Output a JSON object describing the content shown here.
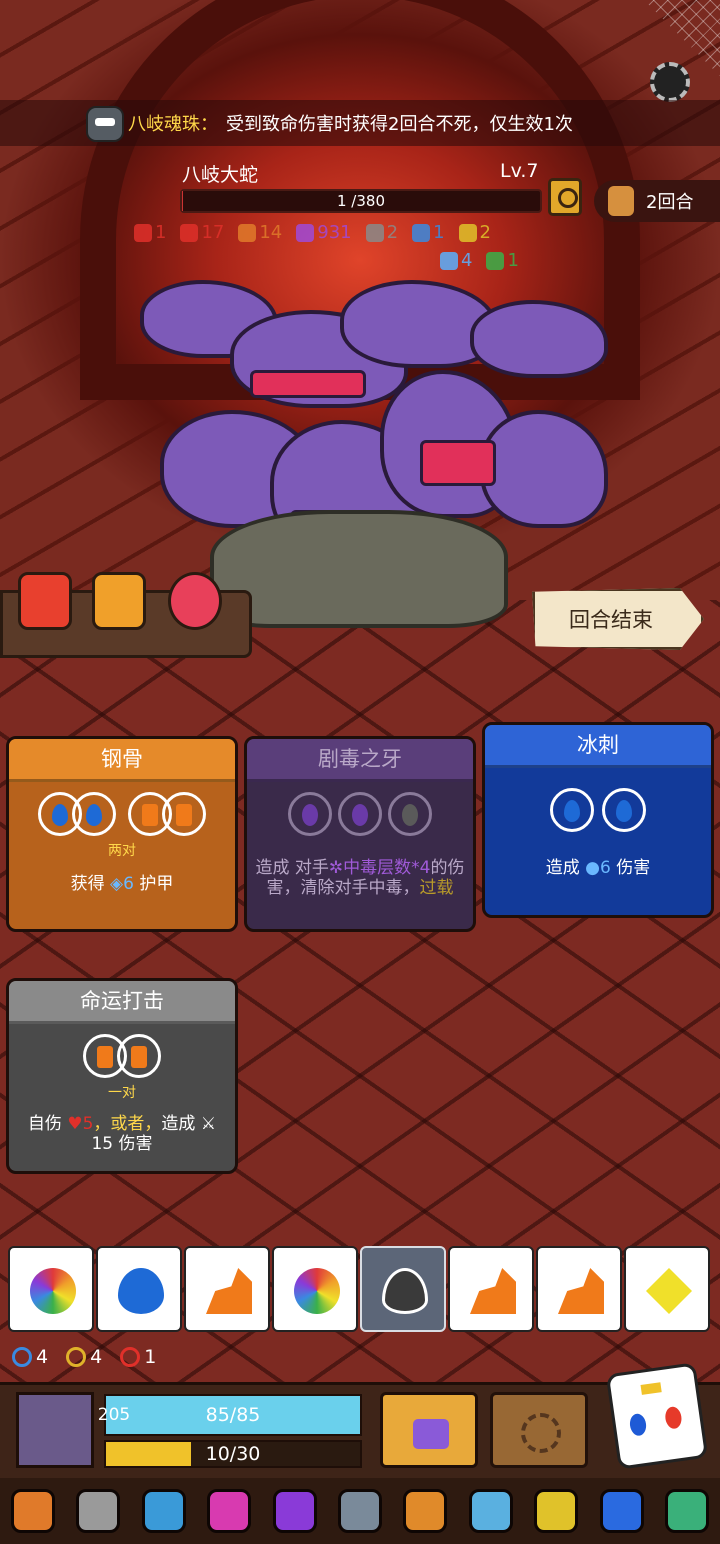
{
  "relic_banner": {
    "name": "八岐魂珠：",
    "text": "受到致命伤害时获得2回合不死，仅生效1次"
  },
  "boss": {
    "name": "八岐大蛇",
    "level": "Lv.7",
    "hp_text": "1 /380",
    "hp_fraction": 0.003
  },
  "turn_counter": "2回合",
  "boss_statuses_row1": [
    {
      "icon": "broken-heart-icon",
      "color": "#e0302a",
      "value": "1"
    },
    {
      "icon": "flame-icon",
      "color": "#e0302a",
      "value": "17"
    },
    {
      "icon": "fire-icon",
      "color": "#e07a2a",
      "value": "14"
    },
    {
      "icon": "poison-icon",
      "color": "#a04ad8",
      "value": "931"
    },
    {
      "icon": "skull-icon",
      "color": "#8a8a8a",
      "value": "2"
    },
    {
      "icon": "chat-icon",
      "color": "#3a8ae0",
      "value": "1"
    },
    {
      "icon": "arrow-icon",
      "color": "#e0c22a",
      "value": "2"
    }
  ],
  "boss_statuses_row2": [
    {
      "icon": "frost-icon",
      "color": "#5ab0ff",
      "value": "4"
    },
    {
      "icon": "leaf-icon",
      "color": "#3ab04a",
      "value": "1"
    }
  ],
  "end_turn_label": "回合结束",
  "cards": {
    "steel_bone": {
      "title": "钢骨",
      "requirement": "两对",
      "desc_pre": "获得",
      "desc_value": "6",
      "desc_post": "护甲"
    },
    "venom_fang": {
      "title": "剧毒之牙",
      "desc_pre": "造成 对手",
      "desc_highlight": "中毒层数*4",
      "desc_mid": "的伤害，清除对手中毒，",
      "desc_end": "过载"
    },
    "ice_spike": {
      "title": "冰刺",
      "desc_pre": "造成",
      "desc_value": "6",
      "desc_post": "伤害"
    },
    "fate_strike": {
      "title": "命运打击",
      "requirement": "一对",
      "desc_pre": "自伤",
      "desc_value": "5",
      "desc_or": "，或者，",
      "desc_mid": "造成",
      "desc_line2": "15 伤害"
    }
  },
  "dice": [
    {
      "face": "rainbow-swirl-icon",
      "selected": false
    },
    {
      "face": "water-drop-icon",
      "selected": false
    },
    {
      "face": "orange-rock-icon",
      "selected": false
    },
    {
      "face": "rainbow-swirl-icon",
      "selected": false
    },
    {
      "face": "gray-flame-icon",
      "selected": true
    },
    {
      "face": "orange-rock-icon",
      "selected": false
    },
    {
      "face": "orange-rock-icon",
      "selected": false
    },
    {
      "face": "yellow-diamond-icon",
      "selected": false
    }
  ],
  "player_buffs": [
    {
      "icon": "blue-shield-icon",
      "color": "#3a8ae0",
      "value": "4"
    },
    {
      "icon": "gold-shield-icon",
      "color": "#e0b22a",
      "value": "4"
    },
    {
      "icon": "red-swirl-icon",
      "color": "#e0302a",
      "value": "1"
    }
  ],
  "player": {
    "shield": "205",
    "hp_text": "85/85",
    "hp_fraction": 1.0,
    "xp_text": "10/30",
    "xp_fraction": 0.333
  },
  "relics": [
    {
      "icon": "crown-icon",
      "color": "#e07a2a"
    },
    {
      "icon": "ghost-icon",
      "color": "#9a9a9a"
    },
    {
      "icon": "blue-box-icon",
      "color": "#3a9ad8"
    },
    {
      "icon": "pink-blob-icon",
      "color": "#d83ab0"
    },
    {
      "icon": "purple-flask-icon",
      "color": "#8a3ad8"
    },
    {
      "icon": "gray-horn-icon",
      "color": "#7a8a9a"
    },
    {
      "icon": "gold-ring-icon",
      "color": "#e08a2a"
    },
    {
      "icon": "crystal-sword-icon",
      "color": "#5ab0e0"
    },
    {
      "icon": "amulet-icon",
      "color": "#e0c22a"
    },
    {
      "icon": "sapphire-medallion-icon",
      "color": "#2a6ae0"
    },
    {
      "icon": "green-leaf-icon",
      "color": "#3ab07a"
    }
  ]
}
